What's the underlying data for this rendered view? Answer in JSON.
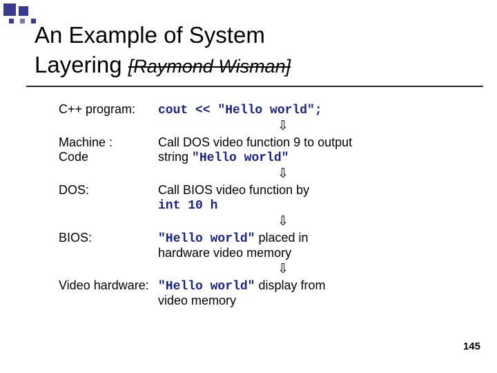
{
  "title_line1": "An Example of System",
  "title_line2_a": "Layering ",
  "title_line2_b": "[Raymond Wisman]",
  "rows": {
    "r1_label": "C++ program:",
    "r1_code": "cout << \"Hello world\";",
    "r2_label_a": "Machine :",
    "r2_label_b": "Code",
    "r2_desc_a": "Call DOS video function 9 to output",
    "r2_desc_b": " string ",
    "r2_code": "\"Hello world\"",
    "r3_label": "DOS:",
    "r3_desc_a": "Call BIOS video function by",
    "r3_code": " int 10 h",
    "r4_label": "BIOS:",
    "r4_code": "\"Hello world\"",
    "r4_desc_a": " placed in",
    "r4_desc_b": " hardware video memory",
    "r5_label": "Video hardware:",
    "r5_code": " \"Hello world\"",
    "r5_desc_a": " display from",
    "r5_desc_b": " video memory"
  },
  "arrow_glyph": "⇩",
  "page_number": "145"
}
